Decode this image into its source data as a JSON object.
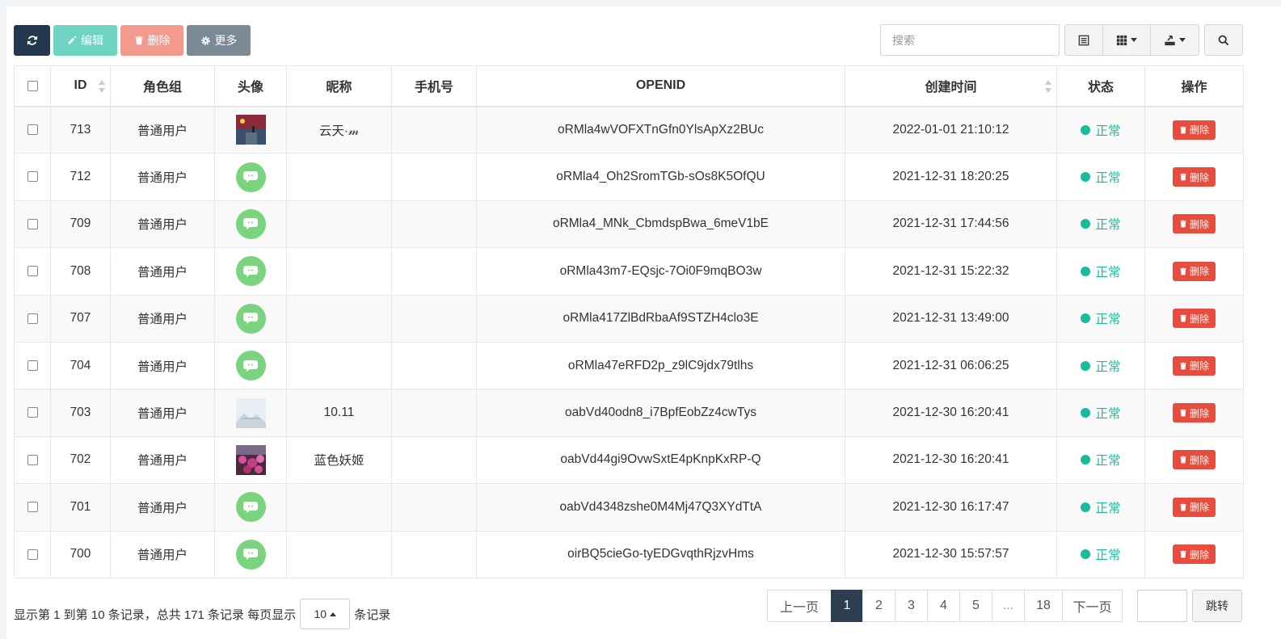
{
  "toolbar": {
    "edit_label": "编辑",
    "delete_label": "删除",
    "more_label": "更多",
    "search_placeholder": "搜索"
  },
  "columns": {
    "id": "ID",
    "group": "角色组",
    "avatar": "头像",
    "nickname": "昵称",
    "phone": "手机号",
    "openid": "OPENID",
    "created": "创建时间",
    "status": "状态",
    "actions": "操作"
  },
  "rows": [
    {
      "id": "713",
      "group": "普通用户",
      "avatar": "photo-flag",
      "nickname": "云天·𝓂",
      "phone": "",
      "openid": "oRMla4wVOFXTnGfn0YlsApXz2BUc",
      "created": "2022-01-01 21:10:12",
      "status": "正常",
      "action": "删除"
    },
    {
      "id": "712",
      "group": "普通用户",
      "avatar": "wechat-default",
      "nickname": "",
      "phone": "",
      "openid": "oRMla4_Oh2SromTGb-sOs8K5OfQU",
      "created": "2021-12-31 18:20:25",
      "status": "正常",
      "action": "删除"
    },
    {
      "id": "709",
      "group": "普通用户",
      "avatar": "wechat-default",
      "nickname": "",
      "phone": "",
      "openid": "oRMla4_MNk_CbmdspBwa_6meV1bE",
      "created": "2021-12-31 17:44:56",
      "status": "正常",
      "action": "删除"
    },
    {
      "id": "708",
      "group": "普通用户",
      "avatar": "wechat-default",
      "nickname": "",
      "phone": "",
      "openid": "oRMla43m7-EQsjc-7Oi0F9mqBO3w",
      "created": "2021-12-31 15:22:32",
      "status": "正常",
      "action": "删除"
    },
    {
      "id": "707",
      "group": "普通用户",
      "avatar": "wechat-default",
      "nickname": "",
      "phone": "",
      "openid": "oRMla417ZlBdRbaAf9STZH4clo3E",
      "created": "2021-12-31 13:49:00",
      "status": "正常",
      "action": "删除"
    },
    {
      "id": "704",
      "group": "普通用户",
      "avatar": "wechat-default",
      "nickname": "",
      "phone": "",
      "openid": "oRMla47eRFD2p_z9lC9jdx79tlhs",
      "created": "2021-12-31 06:06:25",
      "status": "正常",
      "action": "删除"
    },
    {
      "id": "703",
      "group": "普通用户",
      "avatar": "photo-landscape",
      "nickname": "10.11",
      "phone": "",
      "openid": "oabVd40odn8_i7BpfEobZz4cwTys",
      "created": "2021-12-30 16:20:41",
      "status": "正常",
      "action": "删除"
    },
    {
      "id": "702",
      "group": "普通用户",
      "avatar": "photo-flowers",
      "nickname": "蓝色妖姬",
      "phone": "",
      "openid": "oabVd44gi9OvwSxtE4pKnpKxRP-Q",
      "created": "2021-12-30 16:20:41",
      "status": "正常",
      "action": "删除"
    },
    {
      "id": "701",
      "group": "普通用户",
      "avatar": "wechat-default",
      "nickname": "",
      "phone": "",
      "openid": "oabVd4348zshe0M4Mj47Q3XYdTtA",
      "created": "2021-12-30 16:17:47",
      "status": "正常",
      "action": "删除"
    },
    {
      "id": "700",
      "group": "普通用户",
      "avatar": "wechat-default",
      "nickname": "",
      "phone": "",
      "openid": "oirBQ5cieGo-tyEDGvqthRjzvHms",
      "created": "2021-12-30 15:57:57",
      "status": "正常",
      "action": "删除"
    }
  ],
  "footer": {
    "summary": "显示第 1 到第 10 条记录，总共 171 条记录 每页显示",
    "page_size": "10",
    "suffix": "条记录",
    "prev": "上一页",
    "pages": [
      "1",
      "2",
      "3",
      "4",
      "5",
      "...",
      "18"
    ],
    "active_page": "1",
    "next": "下一页",
    "jump": "跳转"
  },
  "colors": {
    "primary": "#23384d",
    "edit": "#6ed3c0",
    "delete": "#f39a8f",
    "more": "#7c8a96",
    "status": "#18bc9c",
    "danger": "#e74c3c",
    "active_page": "#2c3e50"
  }
}
